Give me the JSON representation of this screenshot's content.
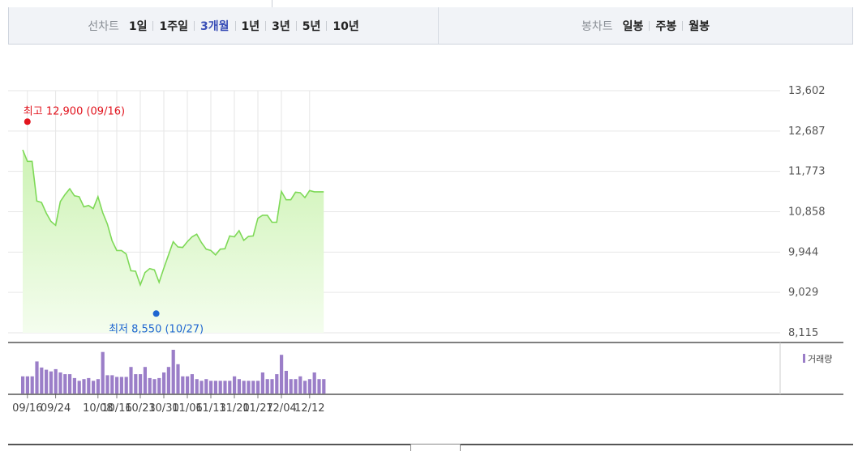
{
  "toolbar": {
    "period_label": "선차트",
    "periods": [
      {
        "label": "1일",
        "active": false
      },
      {
        "label": "1주일",
        "active": false
      },
      {
        "label": "3개월",
        "active": true
      },
      {
        "label": "1년",
        "active": false
      },
      {
        "label": "3년",
        "active": false
      },
      {
        "label": "5년",
        "active": false
      },
      {
        "label": "10년",
        "active": false
      }
    ],
    "candle_label": "봉차트",
    "candles": [
      {
        "label": "일봉"
      },
      {
        "label": "주봉"
      },
      {
        "label": "월봉"
      }
    ]
  },
  "colors": {
    "line": "#7ed957",
    "fill_top": "#cdf3b4",
    "fill_bottom": "#f4fdee",
    "volume": "#9b7ec8",
    "high": "#e2141e",
    "low": "#1f66d1",
    "grid": "#e6e6e6",
    "active_period": "#3a4fb7"
  },
  "chart_data": [
    {
      "type": "area",
      "ylim": [
        8115,
        13602
      ],
      "yticks": [
        "13,602",
        "12,687",
        "11,773",
        "10,858",
        "9,944",
        "9,029",
        "8,115"
      ],
      "xticks": [
        "09/16",
        "09/24",
        "10/08",
        "10/16",
        "10/23",
        "10/30",
        "11/06",
        "11/13",
        "11/20",
        "11/27",
        "12/04",
        "12/12"
      ],
      "high": {
        "value": 12900,
        "date": "09/16",
        "label": "최고 12,900 (09/16)"
      },
      "low": {
        "value": 8550,
        "date": "10/27",
        "label": "최저 8,550 (10/27)"
      },
      "x": [
        "09/15",
        "09/16",
        "09/17",
        "09/18",
        "09/19",
        "09/22",
        "09/23",
        "09/24",
        "09/25",
        "09/26",
        "09/29",
        "09/30",
        "10/01",
        "10/02",
        "10/06",
        "10/07",
        "10/08",
        "10/13",
        "10/14",
        "10/15",
        "10/16",
        "10/17",
        "10/20",
        "10/21",
        "10/22",
        "10/23",
        "10/24",
        "10/27",
        "10/28",
        "10/29",
        "10/30",
        "10/31",
        "11/03",
        "11/04",
        "11/05",
        "11/06",
        "11/07",
        "11/10",
        "11/11",
        "11/12",
        "11/13",
        "11/14",
        "11/17",
        "11/18",
        "11/19",
        "11/20",
        "11/21",
        "11/24",
        "11/25",
        "11/26",
        "11/27",
        "11/28",
        "12/01",
        "12/02",
        "12/03",
        "12/04",
        "12/05",
        "12/08",
        "12/09",
        "12/10",
        "12/11",
        "12/12",
        "12/15",
        "12/16",
        "12/17"
      ],
      "values": [
        12260,
        12000,
        12000,
        11100,
        11070,
        10830,
        10640,
        10550,
        11090,
        11250,
        11380,
        11220,
        11200,
        10970,
        11000,
        10930,
        11200,
        10840,
        10580,
        10200,
        9980,
        9980,
        9900,
        9520,
        9510,
        9200,
        9480,
        9570,
        9540,
        9260,
        9580,
        9880,
        10180,
        10060,
        10050,
        10180,
        10290,
        10350,
        10160,
        10010,
        9980,
        9880,
        10010,
        10020,
        10310,
        10290,
        10430,
        10210,
        10300,
        10310,
        10710,
        10780,
        10780,
        10620,
        10620,
        11320,
        11130,
        11130,
        11300,
        11290,
        11180,
        11340,
        11310,
        11310,
        11310
      ],
      "volume": {
        "label": "거래량",
        "values": [
          31,
          31,
          31,
          58,
          47,
          43,
          40,
          44,
          38,
          35,
          35,
          28,
          23,
          26,
          28,
          23,
          26,
          75,
          33,
          33,
          30,
          30,
          30,
          48,
          35,
          35,
          48,
          28,
          26,
          28,
          38,
          48,
          79,
          53,
          31,
          31,
          35,
          26,
          23,
          26,
          23,
          23,
          23,
          23,
          23,
          31,
          26,
          23,
          23,
          23,
          23,
          38,
          26,
          26,
          35,
          70,
          41,
          26,
          26,
          31,
          23,
          26,
          38,
          26,
          26
        ]
      }
    }
  ]
}
